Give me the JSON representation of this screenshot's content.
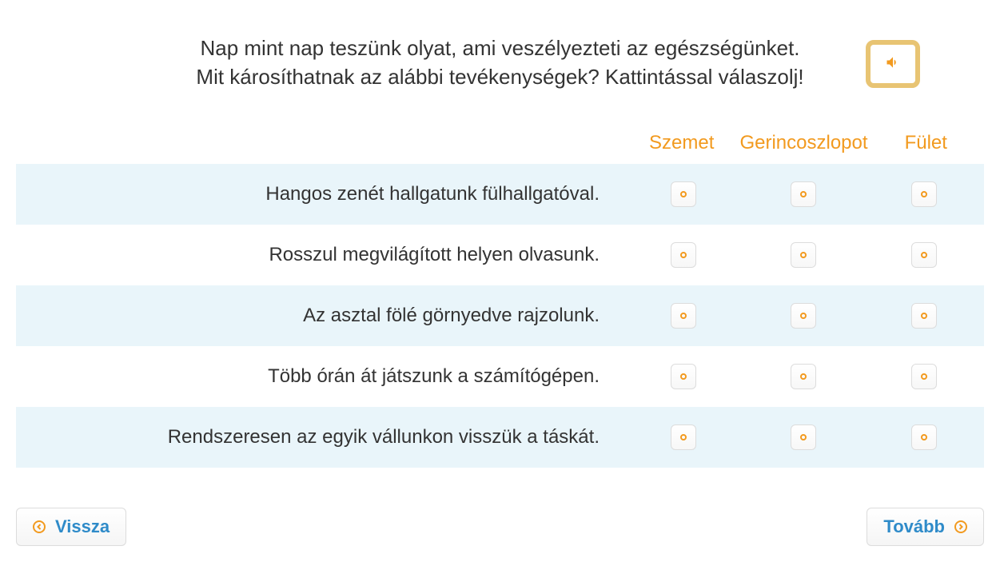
{
  "question": {
    "line1": "Nap mint nap teszünk olyat, ami veszélyezteti az egészségünket.",
    "line2": "Mit károsíthatnak az alábbi tevékenységek? Kattintással válaszolj!"
  },
  "columns": {
    "col1": "Szemet",
    "col2": "Gerincoszlopot",
    "col3": "Fület"
  },
  "rows": {
    "r1": "Hangos zenét hallgatunk fülhallgatóval.",
    "r2": "Rosszul megvilágított helyen olvasunk.",
    "r3": "Az asztal fölé görnyedve rajzolunk.",
    "r4": "Több órán át játszunk a számítógépen.",
    "r5": "Rendszeresen az egyik vállunkon visszük a táskát."
  },
  "nav": {
    "back": "Vissza",
    "next": "Tovább"
  }
}
